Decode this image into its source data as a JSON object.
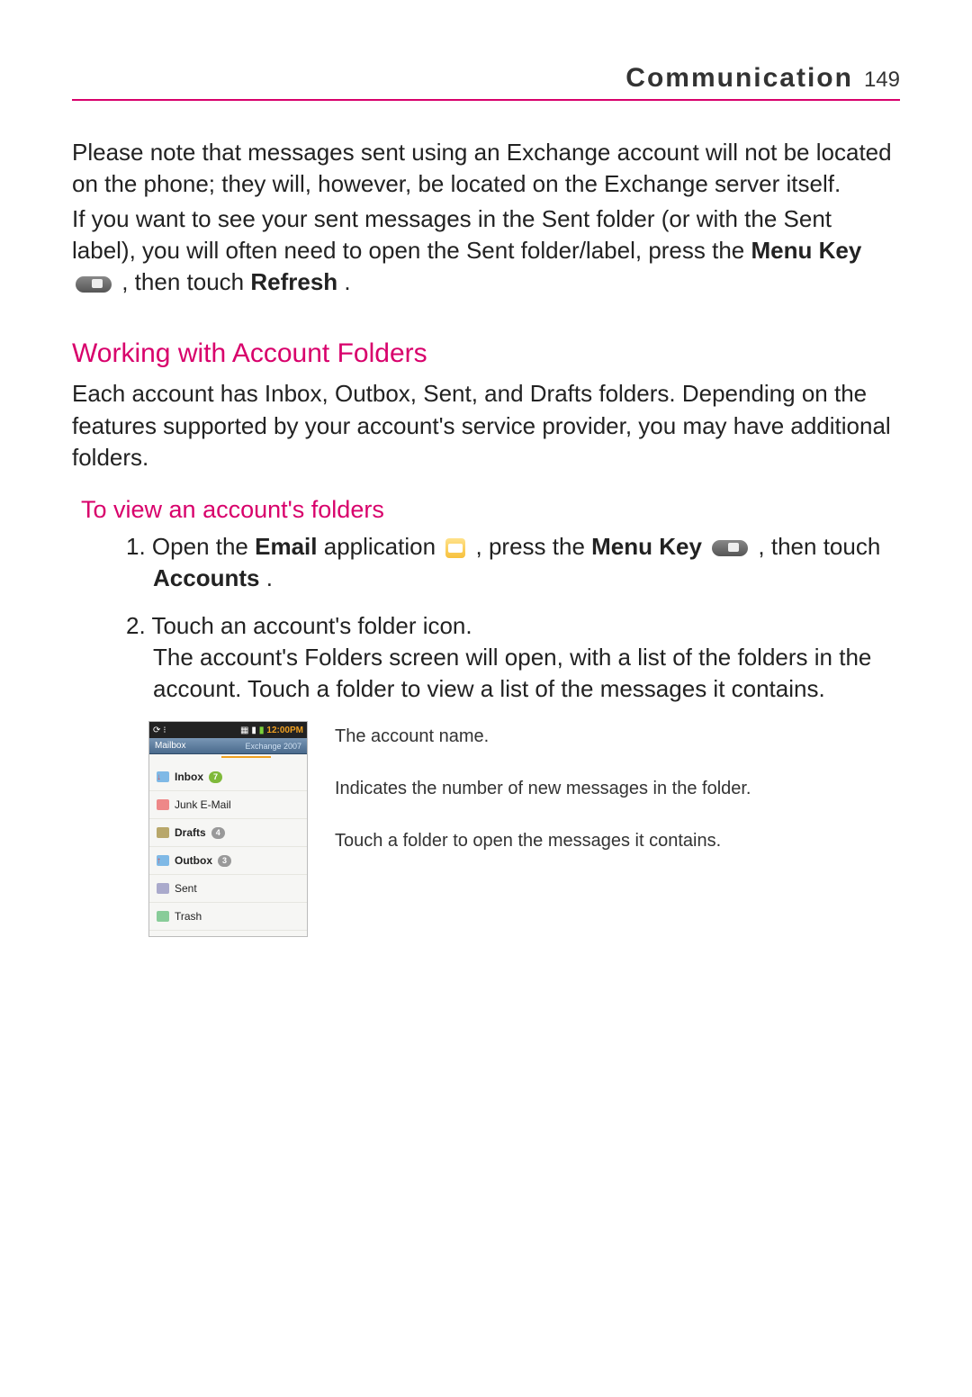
{
  "header": {
    "title": "Communication",
    "page_number": "149"
  },
  "paragraphs": {
    "p1": "Please note that messages sent using an Exchange account will not be located on the phone; they will, however, be located on the Exchange server itself.",
    "p2a": "If you want to see your sent messages in the Sent folder (or with the Sent label), you will often need to open the Sent folder/label, press the ",
    "p2_menu_key": "Menu Key",
    "p2b": " , then touch ",
    "p2_refresh": "Refresh",
    "p2c": "."
  },
  "section1": {
    "heading": "Working with Account Folders",
    "body": "Each account has Inbox, Outbox, Sent, and Drafts folders. Depending on the features supported by your account's service provider, you may have additional folders."
  },
  "section2": {
    "heading": "To view an account's folders",
    "step1_num": "1. ",
    "step1a": "Open the ",
    "step1_email": "Email",
    "step1b": " application ",
    "step1c": ", press the ",
    "step1_menu_key": "Menu Key",
    "step1d": " , then touch ",
    "step1_accounts": "Accounts",
    "step1e": ".",
    "step2_num": "2. ",
    "step2a": "Touch an account's folder icon.",
    "step2b": "The account's Folders screen will open, with a list of the folders in the account. Touch a folder to view a list of the messages it contains."
  },
  "phone": {
    "time": "12:00PM",
    "header_left": "Mailbox",
    "header_right": "Exchange 2007",
    "folders": [
      {
        "label": "Inbox",
        "badge": "7",
        "bold": true,
        "icon": "inbox"
      },
      {
        "label": "Junk E-Mail",
        "icon": "junk"
      },
      {
        "label": "Drafts",
        "badge": "4",
        "bold": true,
        "icon": "drafts",
        "badge_grey": true
      },
      {
        "label": "Outbox",
        "badge": "3",
        "bold": true,
        "icon": "outbox",
        "badge_grey": true
      },
      {
        "label": "Sent",
        "icon": "sent"
      },
      {
        "label": "Trash",
        "icon": "trash"
      }
    ]
  },
  "callouts": {
    "c1": "The account name.",
    "c2": "Indicates the number of new messages in the folder.",
    "c3": "Touch a folder to open the messages it contains."
  }
}
